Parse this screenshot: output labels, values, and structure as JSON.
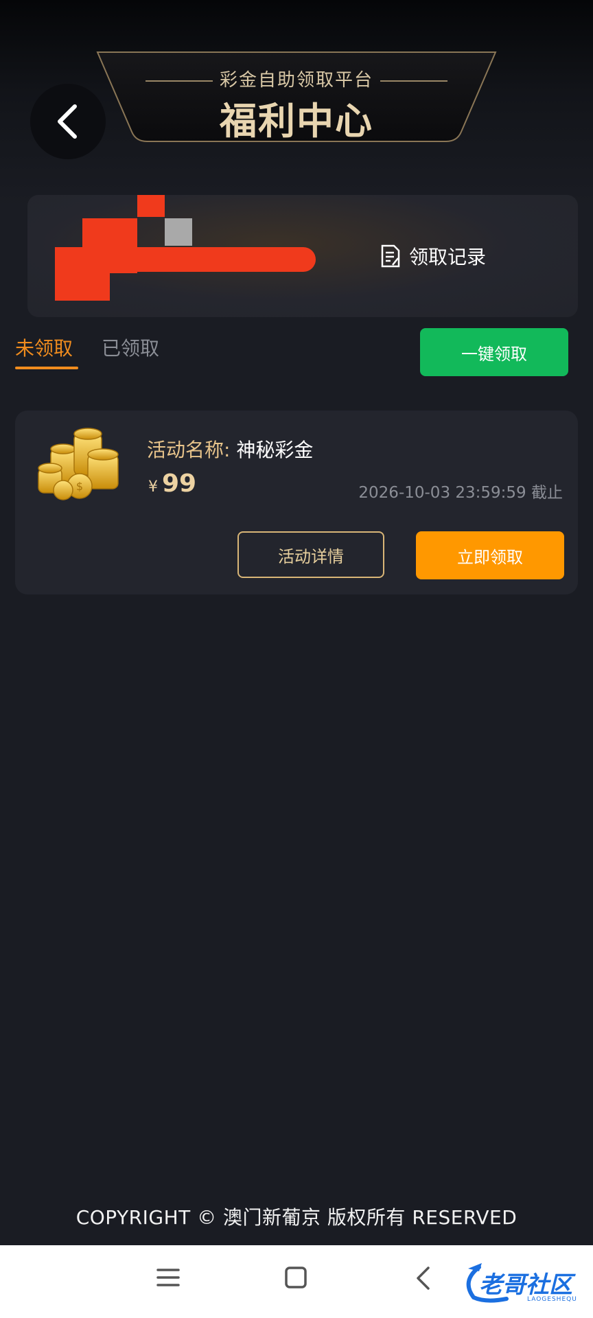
{
  "header": {
    "subtitle": "彩金自助领取平台",
    "title": "福利中心"
  },
  "user_card": {
    "record_label": "领取记录"
  },
  "tabs": [
    {
      "label": "未领取",
      "active": true
    },
    {
      "label": "已领取",
      "active": false
    }
  ],
  "claim_all_label": "一键领取",
  "activity": {
    "name_key": "活动名称:",
    "name_value": "神秘彩金",
    "currency": "¥",
    "amount": "99",
    "deadline": "2026-10-03 23:59:59 截止",
    "detail_label": "活动详情",
    "claim_label": "立即领取"
  },
  "footer": {
    "copyright": "COPYRIGHT © 澳门新葡京 版权所有 RESERVED"
  },
  "watermark": {
    "text": "老哥社区",
    "sub": "LAOGESHEQU"
  },
  "colors": {
    "accent_orange": "#ff9800",
    "accent_green": "#12b95a",
    "gold": "#d9b677",
    "background": "#1a1c23"
  }
}
